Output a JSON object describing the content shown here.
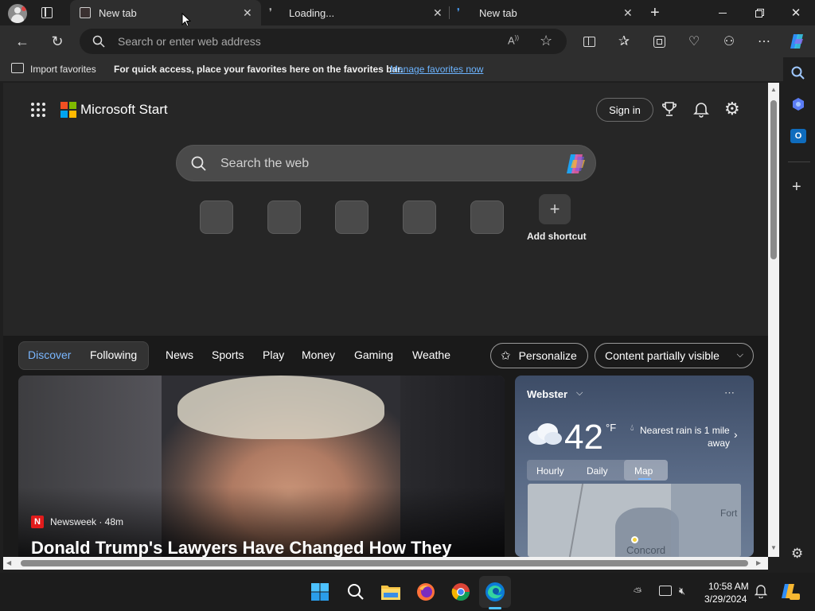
{
  "tabs": [
    {
      "title": "New tab",
      "active": true
    },
    {
      "title": "Loading...",
      "active": false
    },
    {
      "title": "New tab",
      "active": false
    }
  ],
  "address_bar": {
    "placeholder": "Search or enter web address"
  },
  "favorites_bar": {
    "import_label": "Import favorites",
    "message": "For quick access, place your favorites here on the favorites bar.",
    "manage_link": "Manage favorites now"
  },
  "start_page": {
    "brand": "Microsoft Start",
    "sign_in": "Sign in",
    "search_placeholder": "Search the web",
    "add_shortcut": "Add shortcut"
  },
  "feed": {
    "tabs": [
      "Discover",
      "Following",
      "News",
      "Sports",
      "Play",
      "Money",
      "Gaming",
      "Weathe"
    ],
    "active_tab": "Discover",
    "personalize": "Personalize",
    "content_visibility": "Content partially visible"
  },
  "news_card": {
    "source_logo_letter": "N",
    "source": "Newsweek · 48m",
    "headline": "Donald Trump's Lawyers Have Changed How They"
  },
  "weather": {
    "location": "Webster",
    "temperature": "42",
    "unit": "°F",
    "rain_line1": "Nearest rain is 1 mile",
    "rain_line2": "away",
    "tabs": [
      "Hourly",
      "Daily",
      "Map"
    ],
    "active_tab": "Map",
    "map_labels": [
      "Concord",
      "Fort"
    ]
  },
  "taskbar": {
    "time": "10:58 AM",
    "date": "3/29/2024"
  },
  "colors": {
    "accent": "#7ab7ff",
    "link": "#6cb4ff",
    "ms_red": "#f25022",
    "ms_green": "#7fba00",
    "ms_blue": "#00a4ef",
    "ms_yellow": "#ffb900"
  }
}
